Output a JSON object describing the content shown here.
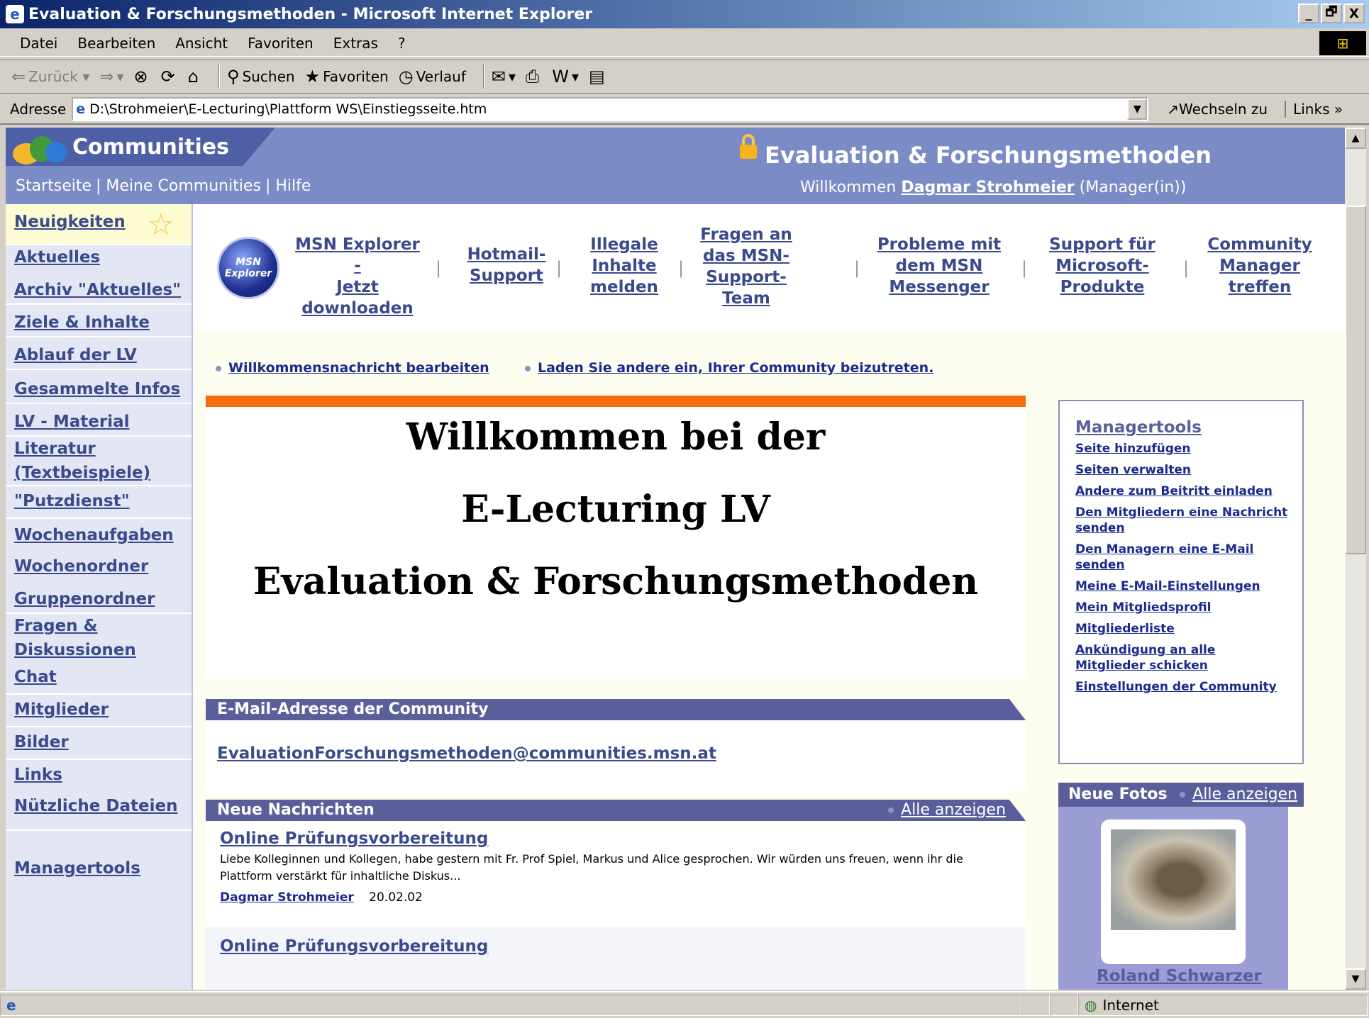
{
  "window": {
    "title": "Evaluation & Forschungsmethoden - Microsoft Internet Explorer",
    "minimize": "_",
    "maximize": "🗗",
    "close": "X"
  },
  "menu": [
    "Datei",
    "Bearbeiten",
    "Ansicht",
    "Favoriten",
    "Extras",
    "?"
  ],
  "toolbar": {
    "back": "Zurück",
    "search": "Suchen",
    "favorites": "Favoriten",
    "history": "Verlauf"
  },
  "address": {
    "label": "Adresse",
    "url": "D:\\Strohmeier\\E-Lecturing\\Plattform WS\\Einstiegsseite.htm",
    "goto": "Wechseln zu",
    "links": "Links"
  },
  "header": {
    "brand": "Communities",
    "nav": [
      "Startseite",
      "Meine Communities",
      "Hilfe"
    ],
    "community_title": "Evaluation & Forschungsmethoden",
    "welcome_prefix": "Willkommen",
    "user": "Dagmar Strohmeier",
    "role": "(Manager(in))"
  },
  "sidebar": [
    "Neuigkeiten",
    "Aktuelles",
    "Archiv \"Aktuelles\"",
    "Ziele & Inhalte",
    "Ablauf der LV",
    "Gesammelte Infos",
    "LV - Material",
    "Literatur (Textbeispiele)",
    "\"Putzdienst\"",
    "Wochenaufgaben",
    "Wochenordner",
    "Gruppenordner",
    "Fragen & Diskussionen",
    "Chat",
    "Mitglieder",
    "Bilder",
    "Links",
    "Nützliche Dateien",
    "Managertools"
  ],
  "msn": {
    "logo_top": "MSN",
    "logo_bottom": "Explorer",
    "links": [
      [
        "MSN Explorer -",
        "Jetzt",
        "downloaden"
      ],
      [
        "Hotmail-",
        "Support"
      ],
      [
        "Illegale",
        "Inhalte",
        "melden"
      ],
      [
        "Fragen an",
        "das MSN-",
        "Support-",
        "Team"
      ],
      [
        "Probleme mit",
        "dem MSN",
        "Messenger"
      ],
      [
        "Support für",
        "Microsoft-",
        "Produkte"
      ],
      [
        "Community",
        "Manager",
        "treffen"
      ]
    ]
  },
  "actions": [
    "Willkommensnachricht bearbeiten",
    "Laden Sie andere ein, Ihrer Community beizutreten."
  ],
  "welcome_lines": [
    "Willkommen bei der",
    "E-Lecturing LV",
    "Evaluation & Forschungsmethoden"
  ],
  "email": {
    "heading": "E-Mail-Adresse der Community",
    "address": "EvaluationForschungsmethoden@communities.msn.at"
  },
  "messages": {
    "heading": "Neue Nachrichten",
    "show_all": "Alle anzeigen",
    "items": [
      {
        "title": "Online Prüfungsvorbereitung",
        "text": "Liebe Kolleginnen und Kollegen, habe gestern mit Fr. Prof Spiel, Markus und Alice gesprochen. Wir würden uns freuen, wenn ihr die Plattform verstärkt für inhaltliche Diskus...",
        "author": "Dagmar Strohmeier",
        "date": "20.02.02"
      },
      {
        "title": "Online Prüfungsvorbereitung"
      }
    ]
  },
  "managertools": {
    "heading": "Managertools",
    "links": [
      "Seite hinzufügen",
      "Seiten verwalten",
      "Andere zum Beitritt einladen",
      "Den Mitgliedern eine Nachricht senden",
      "Den Managern eine E-Mail senden",
      "Meine E-Mail-Einstellungen",
      "Mein Mitgliedsprofil",
      "Mitgliederliste",
      "Ankündigung an alle Mitglieder schicken",
      "Einstellungen der Community"
    ]
  },
  "photos": {
    "heading": "Neue Fotos",
    "show_all": "Alle anzeigen",
    "name": "Roland Schwarzer"
  },
  "status": {
    "zone": "Internet"
  },
  "colors": {
    "header_bg": "#7b8bc5",
    "accent_orange": "#f66b0e",
    "section_bg": "#5a5f9c",
    "link": "#3b4a8c"
  }
}
